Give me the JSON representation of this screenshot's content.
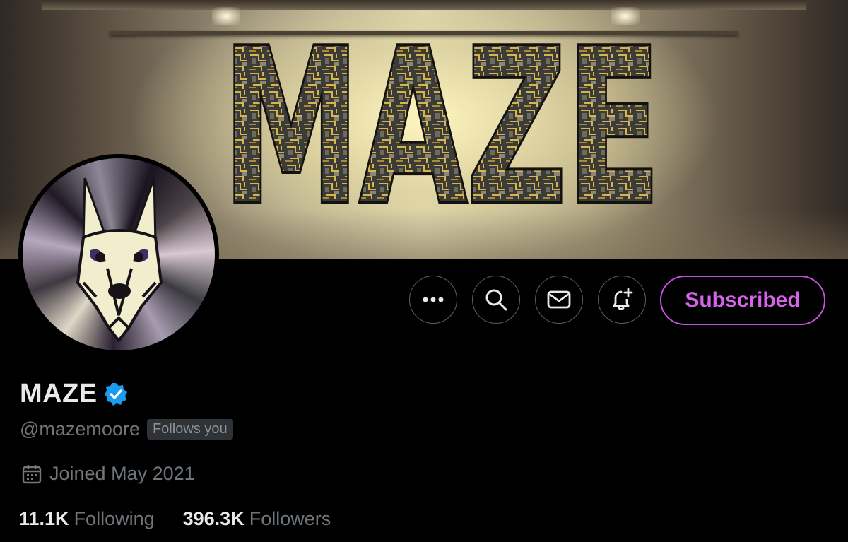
{
  "banner": {
    "logo_text": "MAZE"
  },
  "actions": {
    "more_icon": "more-horizontal-icon",
    "search_icon": "search-icon",
    "message_icon": "envelope-icon",
    "notify_icon": "bell-plus-icon",
    "subscribe_label": "Subscribed"
  },
  "profile": {
    "display_name": "MAZE",
    "verified": true,
    "handle": "@mazemoore",
    "follows_you": "Follows you",
    "joined": "Joined May 2021"
  },
  "stats": {
    "following_count": "11.1K",
    "following_label": "Following",
    "followers_count": "396.3K",
    "followers_label": "Followers"
  },
  "colors": {
    "accent_subscribe": "#d463ea",
    "verified_blue": "#1d9bf0",
    "muted_text": "#71767b"
  }
}
